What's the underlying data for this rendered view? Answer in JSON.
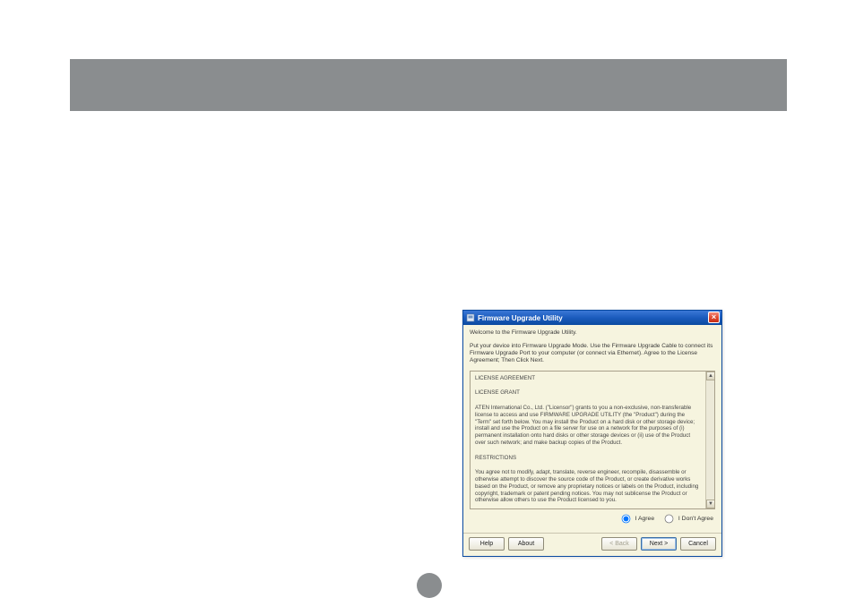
{
  "colors": {
    "gray_bar": "#8a8d8f",
    "titlebar_blue": "#1b5bbd",
    "close_red": "#e24d33",
    "panel_bg": "#f6f4df"
  },
  "dialog": {
    "title": "Firmware Upgrade Utility",
    "intro_line1": "Welcome to the Firmware Upgrade Utility.",
    "intro_line2": "Put your device into Firmware Upgrade Mode. Use the Firmware Upgrade Cable to connect its Firmware Upgrade Port to your computer (or connect via Ethernet). Agree to the License Agreement; Then Click Next.",
    "license": {
      "heading1": "LICENSE AGREEMENT",
      "heading2": "LICENSE GRANT",
      "grant_text": "ATEN International Co., Ltd. (\"Licensor\") grants to you a non-exclusive, non-transferable license to access and use FIRMWARE UPGRADE UTILITY (the \"Product\") during the \"Term\" set forth below. You may install the Product on a hard disk or other storage device; install and use the Product on a file server for use on a network for the purposes of (i) permanent installation onto hard disks or other storage devices or (ii) use of the Product over such network; and make backup copies of the Product.",
      "heading3": "RESTRICTIONS",
      "restrictions_text": "You agree not to modify, adapt, translate, reverse engineer, recompile, disassemble or otherwise attempt to discover the source code of the Product, or create derivative works based on the Product, or remove any proprietary notices or labels on the Product, including copyright, trademark or patent pending notices. You may not sublicense the Product or otherwise allow others to use the Product licensed to you."
    },
    "radios": {
      "agree": "I Agree",
      "dont_agree": "I Don't Agree",
      "selected": "agree"
    },
    "buttons": {
      "help": "Help",
      "about": "About",
      "back": "< Back",
      "next": "Next >",
      "cancel": "Cancel"
    }
  }
}
